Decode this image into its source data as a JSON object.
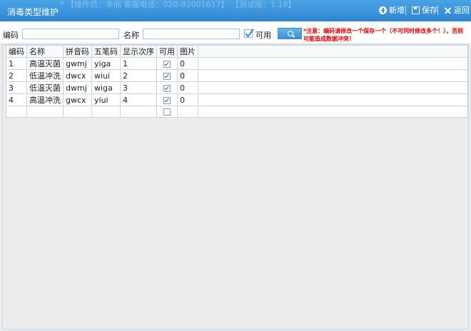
{
  "window": {
    "title": "消毒类型维护",
    "ghost_text": "* 【操作员：李丽 客服电话：020-82001617】  【测试版：1.18】"
  },
  "toolbar": {
    "new_label": "新增",
    "save_label": "保存",
    "back_label": "返回"
  },
  "search": {
    "code_label": "编码",
    "code_value": "",
    "name_label": "名称",
    "name_value": "",
    "enabled_label": "可用",
    "enabled_checked": true,
    "note": "*注意：编码请修改一个保存一个（不可同时修改多个！），否则可能造成数据冲突！"
  },
  "grid": {
    "columns": [
      "编码",
      "名称",
      "拼音码",
      "五笔码",
      "显示次序",
      "可用",
      "图片"
    ],
    "rows": [
      {
        "code": "1",
        "name": "高温灭菌",
        "pinyin": "gwmj",
        "wubi": "yiga",
        "order": "1",
        "enabled": true,
        "picture": "0"
      },
      {
        "code": "2",
        "name": "低温冲洗",
        "pinyin": "dwcx",
        "wubi": "wiui",
        "order": "2",
        "enabled": true,
        "picture": "0"
      },
      {
        "code": "3",
        "name": "低温灭菌",
        "pinyin": "dwmj",
        "wubi": "wiga",
        "order": "3",
        "enabled": true,
        "picture": "0"
      },
      {
        "code": "4",
        "name": "高温冲洗",
        "pinyin": "gwcx",
        "wubi": "yiui",
        "order": "4",
        "enabled": true,
        "picture": "0"
      },
      {
        "code": "",
        "name": "",
        "pinyin": "",
        "wubi": "",
        "order": "",
        "enabled": false,
        "picture": ""
      }
    ]
  }
}
